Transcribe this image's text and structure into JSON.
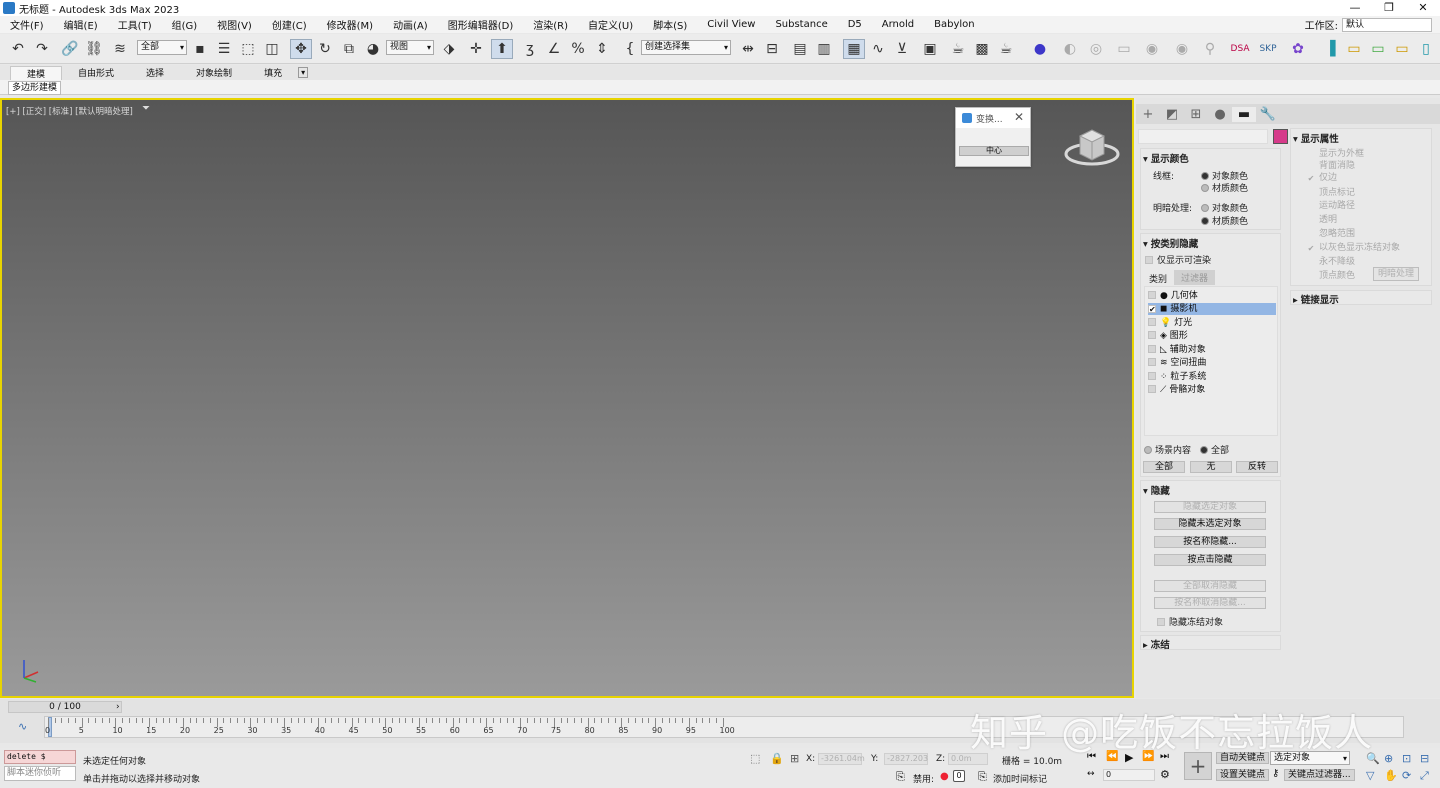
{
  "title": "无标题 - Autodesk 3ds Max 2023",
  "window_buttons": [
    "—",
    "❐",
    "✕"
  ],
  "menu": [
    "文件(F)",
    "编辑(E)",
    "工具(T)",
    "组(G)",
    "视图(V)",
    "创建(C)",
    "修改器(M)",
    "动画(A)",
    "图形编辑器(D)",
    "渲染(R)",
    "自定义(U)",
    "脚本(S)",
    "Civil View",
    "Substance",
    "D5",
    "Arnold",
    "Babylon"
  ],
  "workspace": {
    "label": "工作区:",
    "value": "默认"
  },
  "toolbar": {
    "selection_filter": "全部",
    "ref_coord": "视图",
    "named_selection": "创建选择集"
  },
  "ribbon": {
    "tabs": [
      "建模",
      "自由形式",
      "选择",
      "对象绘制",
      "填充"
    ],
    "active": "建模",
    "sub": "多边形建模"
  },
  "viewport": {
    "label": "[+] [正交] [标准] [默认明暗处理]",
    "border_color": "#e8d400"
  },
  "dialog": {
    "title": "变换...",
    "button": "中心"
  },
  "cmd_panel": {
    "swatch_color": "#d63a8a",
    "display_color": {
      "title": "显示颜色",
      "wire_label": "线框:",
      "shade_label": "明暗处理:",
      "opt_object": "对象颜色",
      "opt_material": "材质颜色"
    },
    "hide_by_category": {
      "title": "按类别隐藏",
      "renderable_only": "仅显示可渲染",
      "tab_category": "类别",
      "tab_filter": "过滤器",
      "categories": [
        {
          "label": "几何体",
          "checked": false,
          "selected": false
        },
        {
          "label": "摄影机",
          "checked": true,
          "selected": true
        },
        {
          "label": "灯光",
          "checked": false,
          "selected": false
        },
        {
          "label": "图形",
          "checked": false,
          "selected": false
        },
        {
          "label": "辅助对象",
          "checked": false,
          "selected": false
        },
        {
          "label": "空间扭曲",
          "checked": false,
          "selected": false
        },
        {
          "label": "粒子系统",
          "checked": false,
          "selected": false
        },
        {
          "label": "骨骼对象",
          "checked": false,
          "selected": false
        }
      ],
      "scene_content": "场景内容",
      "all_radio": "全部",
      "btn_all": "全部",
      "btn_none": "无",
      "btn_invert": "反转"
    },
    "hide": {
      "title": "隐藏",
      "hide_selected": "隐藏选定对象",
      "hide_unselected": "隐藏未选定对象",
      "hide_by_name": "按名称隐藏...",
      "hide_by_hit": "按点击隐藏",
      "unhide_all": "全部取消隐藏",
      "unhide_by_name": "按名称取消隐藏...",
      "hide_frozen": "隐藏冻结对象"
    },
    "freeze": {
      "title": "冻结"
    },
    "display_props": {
      "title": "显示属性",
      "items": [
        "显示为外框",
        "背面消隐",
        "仅边",
        "顶点标记",
        "运动路径",
        "透明",
        "忽略范围",
        "以灰色显示冻结对象",
        "永不降级",
        "顶点颜色"
      ],
      "checked": [
        false,
        false,
        true,
        false,
        false,
        false,
        false,
        true,
        false,
        false
      ],
      "shading_btn": "明暗处理"
    },
    "link_display": {
      "title": "链接显示"
    }
  },
  "timeline": {
    "slider": "0 / 100",
    "ticks": [
      "0",
      "5",
      "10",
      "15",
      "20",
      "25",
      "30",
      "35",
      "40",
      "45",
      "50",
      "55",
      "60",
      "65",
      "70",
      "75",
      "80",
      "85",
      "90",
      "95",
      "100"
    ]
  },
  "status": {
    "maxscript_input": "delete $",
    "maxscript_hint": "脚本迷你侦听",
    "line1": "未选定任何对象",
    "line2": "单击并拖动以选择并移动对象",
    "x_label": "X:",
    "x_value": "-3261.04m",
    "y_label": "Y:",
    "y_value": "-2827.203",
    "z_label": "Z:",
    "z_value": "0.0m",
    "grid": "栅格 = 10.0m",
    "disabled": "禁用:",
    "add_time_tag": "添加时间标记",
    "auto_key": "自动关键点",
    "set_key": "设置关键点",
    "selected_objects": "选定对象",
    "key_filters": "关键点过滤器...",
    "frame": "0"
  },
  "watermark": "知乎 @吃饭不忘拉饭人"
}
